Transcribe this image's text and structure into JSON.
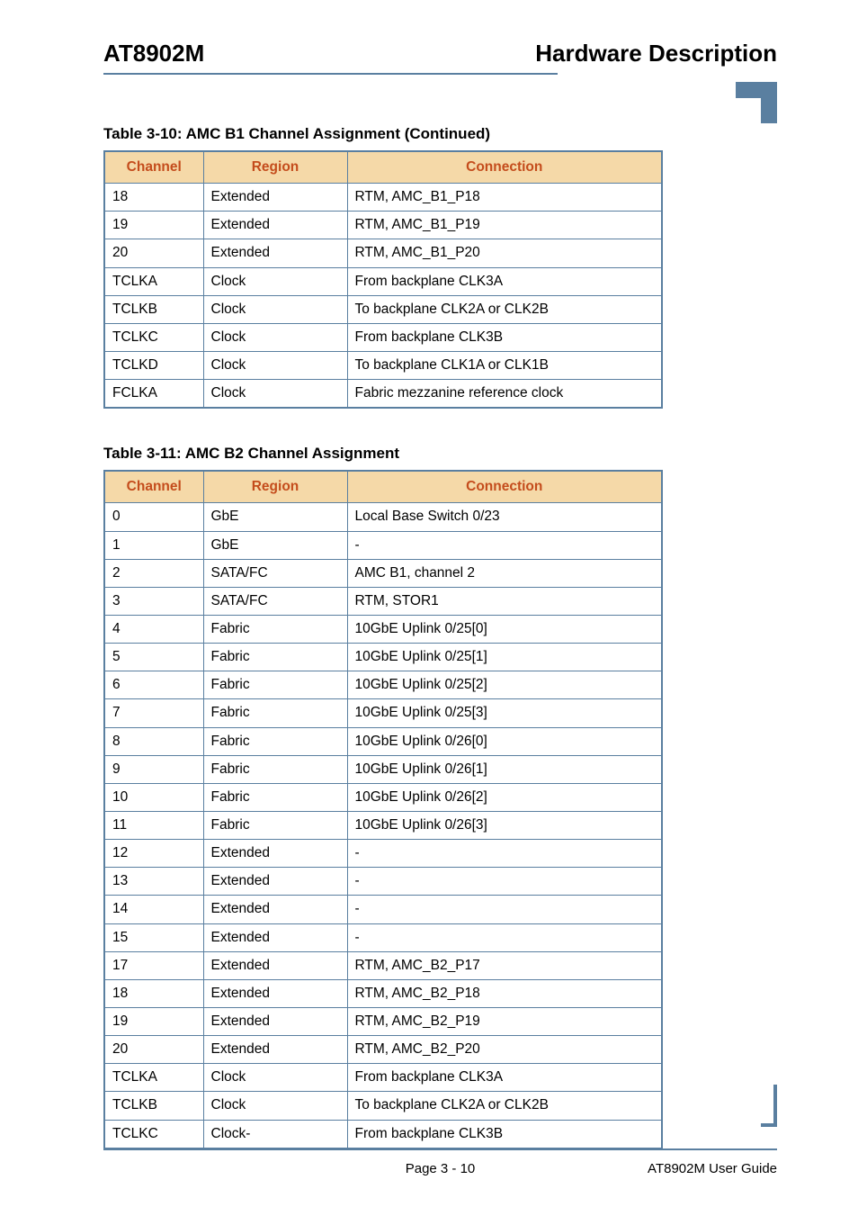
{
  "header": {
    "left": "AT8902M",
    "right": "Hardware Description"
  },
  "table1": {
    "caption": "Table 3-10:  AMC B1 Channel Assignment  (Continued)",
    "headers": {
      "channel": "Channel",
      "region": "Region",
      "connection": "Connection"
    },
    "rows": [
      {
        "channel": "18",
        "region": "Extended",
        "connection": "RTM, AMC_B1_P18"
      },
      {
        "channel": "19",
        "region": "Extended",
        "connection": "RTM, AMC_B1_P19"
      },
      {
        "channel": "20",
        "region": "Extended",
        "connection": "RTM, AMC_B1_P20"
      },
      {
        "channel": "TCLKA",
        "region": "Clock",
        "connection": "From backplane CLK3A"
      },
      {
        "channel": "TCLKB",
        "region": "Clock",
        "connection": "To backplane CLK2A or CLK2B"
      },
      {
        "channel": "TCLKC",
        "region": "Clock",
        "connection": "From backplane CLK3B"
      },
      {
        "channel": "TCLKD",
        "region": "Clock",
        "connection": "To backplane CLK1A or CLK1B"
      },
      {
        "channel": "FCLKA",
        "region": "Clock",
        "connection": "Fabric mezzanine reference clock"
      }
    ]
  },
  "table2": {
    "caption": "Table 3-11:  AMC B2 Channel Assignment",
    "headers": {
      "channel": "Channel",
      "region": "Region",
      "connection": "Connection"
    },
    "rows": [
      {
        "channel": "0",
        "region": "GbE",
        "connection": "Local Base Switch 0/23"
      },
      {
        "channel": "1",
        "region": "GbE",
        "connection": "-"
      },
      {
        "channel": "2",
        "region": "SATA/FC",
        "connection": "AMC B1, channel 2"
      },
      {
        "channel": "3",
        "region": "SATA/FC",
        "connection": "RTM, STOR1"
      },
      {
        "channel": "4",
        "region": "Fabric",
        "connection": "10GbE Uplink 0/25[0]"
      },
      {
        "channel": "5",
        "region": "Fabric",
        "connection": "10GbE Uplink 0/25[1]"
      },
      {
        "channel": "6",
        "region": "Fabric",
        "connection": "10GbE Uplink 0/25[2]"
      },
      {
        "channel": "7",
        "region": "Fabric",
        "connection": "10GbE Uplink 0/25[3]"
      },
      {
        "channel": "8",
        "region": "Fabric",
        "connection": "10GbE Uplink 0/26[0]"
      },
      {
        "channel": "9",
        "region": "Fabric",
        "connection": "10GbE Uplink 0/26[1]"
      },
      {
        "channel": "10",
        "region": "Fabric",
        "connection": "10GbE Uplink 0/26[2]"
      },
      {
        "channel": "11",
        "region": "Fabric",
        "connection": "10GbE Uplink 0/26[3]"
      },
      {
        "channel": "12",
        "region": "Extended",
        "connection": "-"
      },
      {
        "channel": "13",
        "region": "Extended",
        "connection": "-"
      },
      {
        "channel": "14",
        "region": "Extended",
        "connection": "-"
      },
      {
        "channel": "15",
        "region": "Extended",
        "connection": "-"
      },
      {
        "channel": "17",
        "region": "Extended",
        "connection": "RTM, AMC_B2_P17"
      },
      {
        "channel": "18",
        "region": "Extended",
        "connection": "RTM, AMC_B2_P18"
      },
      {
        "channel": "19",
        "region": "Extended",
        "connection": "RTM, AMC_B2_P19"
      },
      {
        "channel": "20",
        "region": "Extended",
        "connection": "RTM, AMC_B2_P20"
      },
      {
        "channel": "TCLKA",
        "region": "Clock",
        "connection": "From backplane CLK3A"
      },
      {
        "channel": "TCLKB",
        "region": "Clock",
        "connection": "To backplane CLK2A or CLK2B"
      },
      {
        "channel": "TCLKC",
        "region": "Clock-",
        "connection": "From backplane CLK3B"
      }
    ]
  },
  "footer": {
    "page": "Page 3 - 10",
    "guide": "AT8902M User Guide"
  }
}
